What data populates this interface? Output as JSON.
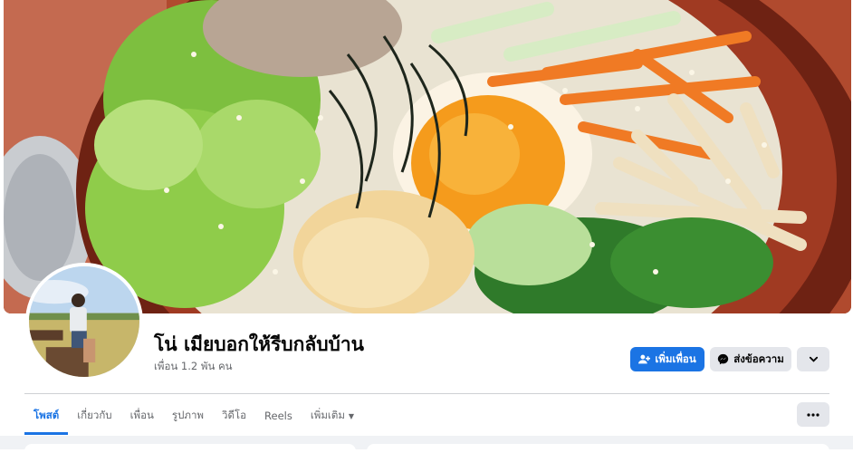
{
  "profile": {
    "name": "โน่ เมียบอกให้รีบกลับบ้าน",
    "friends": "เพื่อน 1.2 พัน คน"
  },
  "actions": {
    "add_friend": "เพิ่มเพื่อน",
    "message": "ส่งข้อความ"
  },
  "tabs": [
    {
      "label": "โพสต์",
      "active": true
    },
    {
      "label": "เกี่ยวกับ",
      "active": false
    },
    {
      "label": "เพื่อน",
      "active": false
    },
    {
      "label": "รูปภาพ",
      "active": false
    },
    {
      "label": "วิดีโอ",
      "active": false
    },
    {
      "label": "Reels",
      "active": false
    },
    {
      "label": "เพิ่มเติม",
      "active": false
    }
  ],
  "icons": {
    "add_friend": "person-add-icon",
    "message": "messenger-icon",
    "more": "chevron-down-icon",
    "tabs_more": "ellipsis-icon",
    "dropdown": "caret-down-icon"
  },
  "colors": {
    "accent": "#1b74e4",
    "secondary_button": "#e4e6eb",
    "muted_text": "#65676b",
    "feed_background": "#f0f2f5"
  }
}
